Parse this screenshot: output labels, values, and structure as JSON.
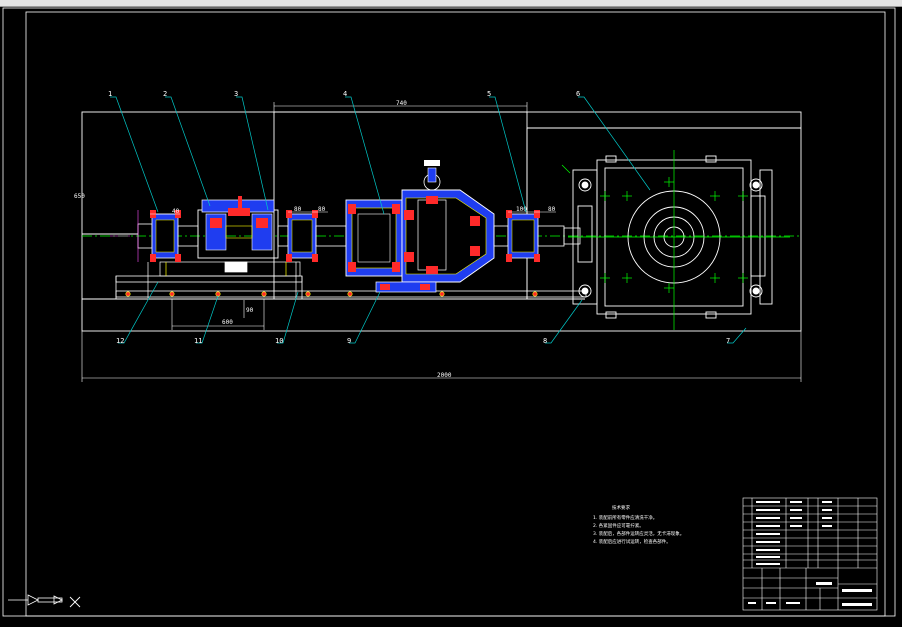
{
  "drawing": {
    "part_labels": [
      "1",
      "2",
      "3",
      "4",
      "5",
      "6",
      "7",
      "8",
      "9",
      "10",
      "11",
      "12"
    ],
    "dimensions": {
      "top_span": "740",
      "overall_length": "2000",
      "height_left": "650",
      "bottom_mid": "600",
      "bottom_vertical": "90",
      "coupling_left": "40",
      "coupling_right_a": "80",
      "coupling_right_b": "80",
      "coupling_far_a": "100",
      "coupling_far_b": "80"
    },
    "tech_notes": {
      "title": "技术要求",
      "items": [
        "1. 装配前所有零件应清洗干净。",
        "2. 各紧固件应可靠拧紧。",
        "3. 装配后，各部件运转应灵活，无卡滞现象。",
        "4. 装配后应进行试运转，检查各部件。"
      ]
    }
  },
  "colors": {
    "background": "#000000",
    "outline": "#ffffff",
    "centerline": "#00ff00",
    "leader": "#00c8c8",
    "section_blue": "#1f3df0",
    "bearing_red": "#ff2a2a",
    "hatch_yellow": "#ffff00",
    "dim_magenta": "#ff4fff"
  },
  "icons": {
    "ucs": "ucs-axis-icon",
    "crosshair": "crosshair-cursor-icon"
  }
}
